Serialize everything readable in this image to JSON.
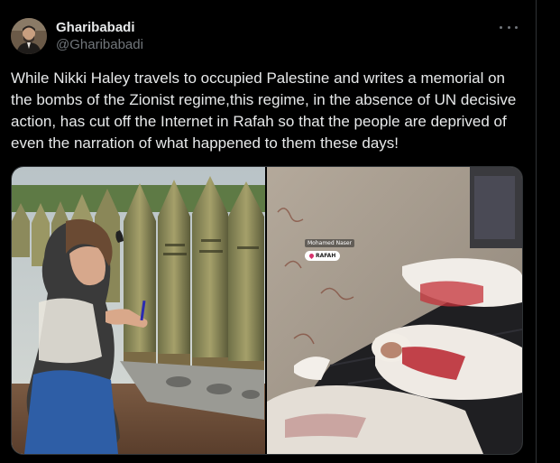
{
  "author": {
    "display_name": "Gharibabadi",
    "handle": "@Gharibabadi"
  },
  "tweet": {
    "text": "While Nikki Haley travels to occupied Palestine and writes a memorial on the bombs of the Zionist regime,this regime, in the absence of UN decisive action, has cut off the Internet in Rafah so that the people are deprived of even the narration of what happened to them these days!"
  },
  "media": {
    "right_photo_tag_name": "Mohamed Naser",
    "right_photo_tag_location": "RAFAH"
  },
  "icons": {
    "more": "more-options-icon",
    "location": "location-pin-icon"
  },
  "colors": {
    "background": "#000000",
    "text_primary": "#e7e9ea",
    "text_secondary": "#71767b",
    "border": "#2f3336"
  }
}
